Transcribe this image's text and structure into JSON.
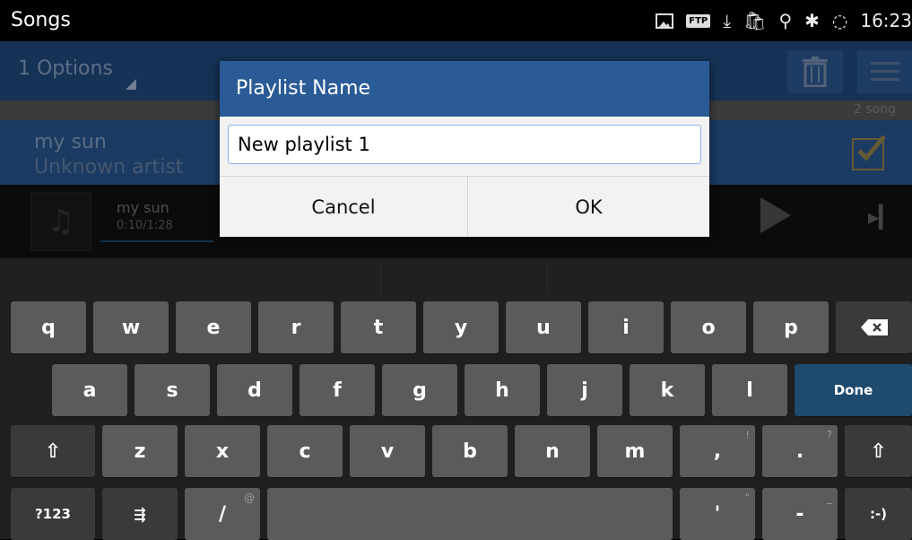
{
  "status_bar": {
    "title": "Songs",
    "ftp_label": "FTP",
    "time": "16:23"
  },
  "action_bar": {
    "options_label": "1 Options"
  },
  "list": {
    "count_label": "2 song",
    "item": {
      "title": "my sun",
      "artist": "Unknown artist",
      "checked": true
    }
  },
  "player": {
    "title": "my sun",
    "time": "0:10/1:28",
    "progress": 0.114
  },
  "dialog": {
    "title": "Playlist Name",
    "input_value": "New playlist 1",
    "cancel_label": "Cancel",
    "ok_label": "OK"
  },
  "keyboard": {
    "row1": [
      "q",
      "w",
      "e",
      "r",
      "t",
      "y",
      "u",
      "i",
      "o",
      "p"
    ],
    "row2": [
      "a",
      "s",
      "d",
      "f",
      "g",
      "h",
      "j",
      "k",
      "l"
    ],
    "row3": [
      "z",
      "x",
      "c",
      "v",
      "b",
      "n",
      "m"
    ],
    "done_label": "Done",
    "symbols_label": "?123",
    "smiley_label": ":-)",
    "slash_label": "/",
    "slash_hint": "@",
    "comma_label": ",",
    "comma_hint": "!",
    "period_label": ".",
    "period_hint": "?",
    "apostrophe_label": "'",
    "apostrophe_hint": "\"",
    "dash_label": "-",
    "dash_hint": "_"
  },
  "colors": {
    "accent": "#224d85",
    "dialog_header": "#2a5b97",
    "done_key": "#1e4a6e"
  }
}
